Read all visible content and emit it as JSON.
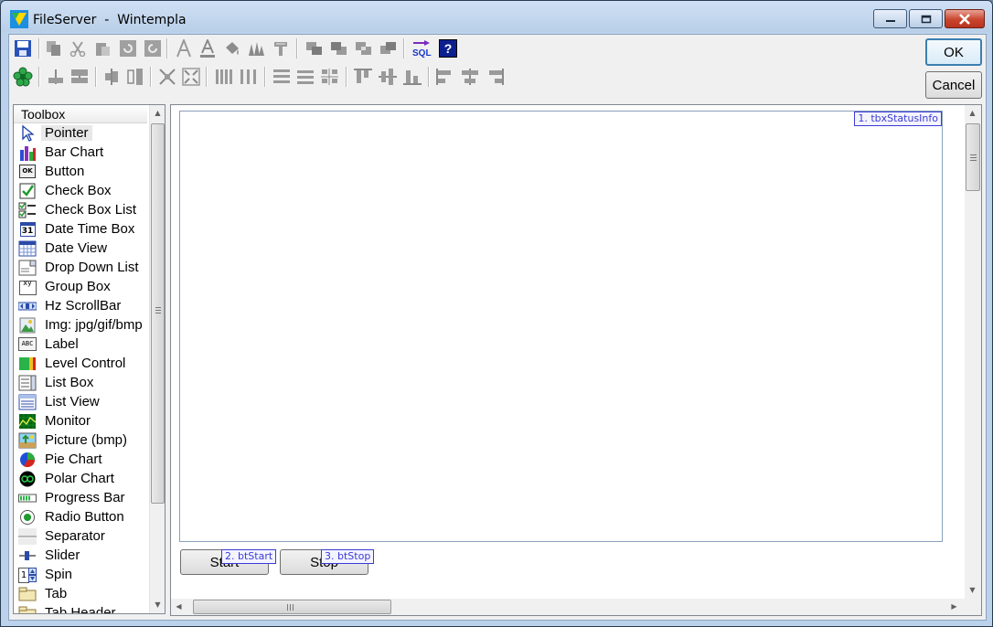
{
  "window": {
    "title": "FileServer  -  Wintempla",
    "controls": [
      "minimize-icon",
      "maximize-icon",
      "close-icon"
    ]
  },
  "toolbar": {
    "row1_icons": [
      "save-icon",
      "copy-icon",
      "cut-icon",
      "paste-icon",
      "undo-icon",
      "redo-icon",
      "font-icon",
      "font-color-icon",
      "fill-color-icon",
      "pen-color-icon",
      "format-icon",
      "bring-forward-icon",
      "send-backward-icon",
      "bring-to-front-icon",
      "send-to-back-icon",
      "sql-icon",
      "help-icon"
    ],
    "row2_icons": [
      "event-icon",
      "align-left-icon",
      "align-right-icon",
      "align-hcenter-icon",
      "align-vcenter-icon",
      "same-size-icon",
      "same-size2-icon",
      "space-horizontal-icon",
      "space-horizontal2-icon",
      "space-vertical-icon",
      "space-vertical2-icon",
      "space-vertical3-icon",
      "align-top-icon",
      "align-middle-icon",
      "align-bottom-icon",
      "align-left-edge-icon",
      "align-center-edge-icon",
      "align-right-edge-icon"
    ],
    "sql_label": "SQL",
    "help_label": "?"
  },
  "dialog": {
    "ok_label": "OK",
    "cancel_label": "Cancel"
  },
  "toolbox": {
    "header": "Toolbox",
    "items": [
      {
        "label": "Pointer",
        "icon": "pointer-icon"
      },
      {
        "label": "Bar Chart",
        "icon": "bar-chart-icon"
      },
      {
        "label": "Button",
        "icon": "button-icon"
      },
      {
        "label": "Check Box",
        "icon": "check-box-icon"
      },
      {
        "label": "Check Box List",
        "icon": "check-box-list-icon"
      },
      {
        "label": "Date Time Box",
        "icon": "date-time-box-icon"
      },
      {
        "label": "Date View",
        "icon": "date-view-icon"
      },
      {
        "label": "Drop Down List",
        "icon": "drop-down-list-icon"
      },
      {
        "label": "Group Box",
        "icon": "group-box-icon"
      },
      {
        "label": "Hz ScrollBar",
        "icon": "hz-scrollbar-icon"
      },
      {
        "label": "Img: jpg/gif/bmp",
        "icon": "image-icon"
      },
      {
        "label": "Label",
        "icon": "label-icon"
      },
      {
        "label": "Level Control",
        "icon": "level-control-icon"
      },
      {
        "label": "List Box",
        "icon": "list-box-icon"
      },
      {
        "label": "List View",
        "icon": "list-view-icon"
      },
      {
        "label": "Monitor",
        "icon": "monitor-icon"
      },
      {
        "label": "Picture (bmp)",
        "icon": "picture-icon"
      },
      {
        "label": "Pie Chart",
        "icon": "pie-chart-icon"
      },
      {
        "label": "Polar Chart",
        "icon": "polar-chart-icon"
      },
      {
        "label": "Progress Bar",
        "icon": "progress-bar-icon"
      },
      {
        "label": "Radio Button",
        "icon": "radio-button-icon"
      },
      {
        "label": "Separator",
        "icon": "separator-icon"
      },
      {
        "label": "Slider",
        "icon": "slider-icon"
      },
      {
        "label": "Spin",
        "icon": "spin-icon"
      },
      {
        "label": "Tab",
        "icon": "tab-icon"
      },
      {
        "label": "Tab Header",
        "icon": "tab-header-icon"
      }
    ],
    "icon_text": {
      "button": "OK",
      "date": "31",
      "group": "xy",
      "label": "ABC",
      "spin": "1"
    }
  },
  "designer": {
    "controls": [
      {
        "tag": "1. tbxStatusInfo"
      },
      {
        "tag": "2. btStart",
        "label": "Start"
      },
      {
        "tag": "3. btStop",
        "label": "Stop"
      }
    ]
  }
}
